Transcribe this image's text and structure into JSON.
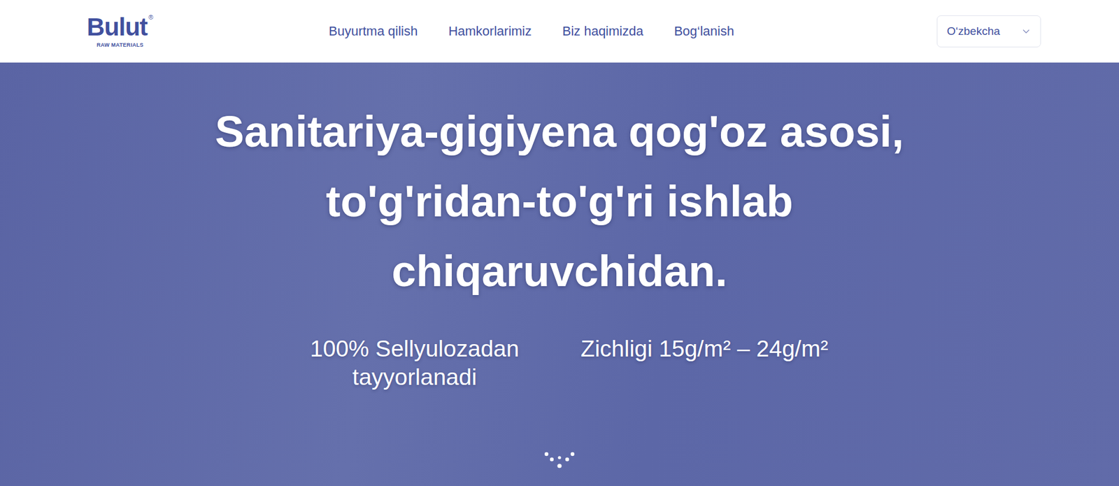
{
  "header": {
    "logo": {
      "name": "Bulut",
      "mark": "®",
      "tagline": "RAW MATERIALS"
    },
    "nav": [
      {
        "label": "Buyurtma qilish"
      },
      {
        "label": "Hamkorlarimiz"
      },
      {
        "label": "Biz haqimizda"
      },
      {
        "label": "Bog‘lanish"
      }
    ],
    "language": {
      "value": "O‘zbekcha"
    }
  },
  "hero": {
    "headline": "Sanitariya-gigiyena qog'oz asosi, to'g'ridan-to'g'ri ishlab chiqaruvchidan.",
    "features": [
      {
        "text": "100% Sellyulozadan tayyorlanadi"
      },
      {
        "text": "Zichligi 15g/m² – 24g/m²"
      }
    ]
  }
}
